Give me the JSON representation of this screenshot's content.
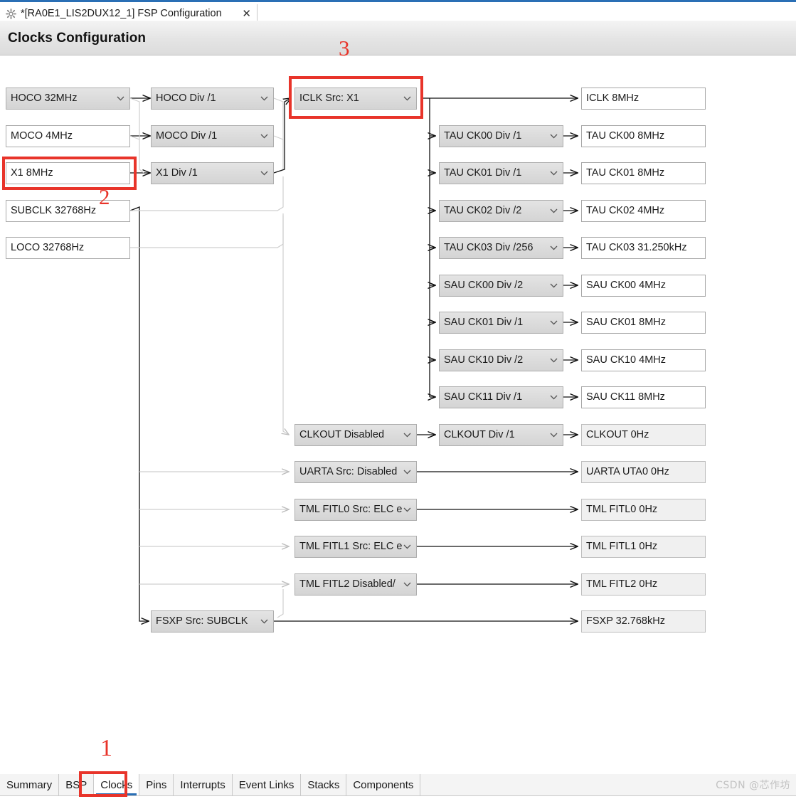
{
  "window": {
    "tab_title": "*[RA0E1_LIS2DUX12_1] FSP Configuration",
    "close_label": "✕",
    "gear_icon": "gear-icon"
  },
  "header": {
    "title": "Clocks Configuration"
  },
  "annotations": [
    {
      "id": "1",
      "label": "1",
      "target": "clocks-tab"
    },
    {
      "id": "2",
      "label": "2",
      "target": "x1-source-node"
    },
    {
      "id": "3",
      "label": "3",
      "target": "iclk-src-node"
    }
  ],
  "diagram": {
    "sources": [
      {
        "name": "hoco-source",
        "label": "HOCO 32MHz",
        "type": "combo"
      },
      {
        "name": "moco-source",
        "label": "MOCO 4MHz",
        "type": "static"
      },
      {
        "name": "x1-source",
        "label": "X1 8MHz",
        "type": "static"
      },
      {
        "name": "subclk-source",
        "label": "SUBCLK 32768Hz",
        "type": "static"
      },
      {
        "name": "loco-source",
        "label": "LOCO 32768Hz",
        "type": "static"
      }
    ],
    "dividers": [
      {
        "name": "hoco-div",
        "label": "HOCO Div /1"
      },
      {
        "name": "moco-div",
        "label": "MOCO Div /1"
      },
      {
        "name": "x1-div",
        "label": "X1 Div /1"
      },
      {
        "name": "fsxp-src",
        "label": "FSXP Src: SUBCLK"
      }
    ],
    "selectors": [
      {
        "name": "iclk-src",
        "label": "ICLK Src: X1"
      },
      {
        "name": "clkout-src",
        "label": "CLKOUT Disabled"
      },
      {
        "name": "uarta-src",
        "label": "UARTA Src: Disabled"
      },
      {
        "name": "tml-fitl0-src",
        "label": "TML FITL0 Src: ELC e"
      },
      {
        "name": "tml-fitl1-src",
        "label": "TML FITL1 Src: ELC e"
      },
      {
        "name": "tml-fitl2-src",
        "label": "TML FITL2 Disabled/"
      }
    ],
    "peripheral_divs": [
      {
        "name": "tau-ck00-div",
        "label": "TAU CK00 Div /1"
      },
      {
        "name": "tau-ck01-div",
        "label": "TAU CK01 Div /1"
      },
      {
        "name": "tau-ck02-div",
        "label": "TAU CK02 Div /2"
      },
      {
        "name": "tau-ck03-div",
        "label": "TAU CK03 Div /256"
      },
      {
        "name": "sau-ck00-div",
        "label": "SAU CK00 Div /2"
      },
      {
        "name": "sau-ck01-div",
        "label": "SAU CK01 Div /1"
      },
      {
        "name": "sau-ck10-div",
        "label": "SAU CK10 Div /2"
      },
      {
        "name": "sau-ck11-div",
        "label": "SAU CK11 Div /1"
      },
      {
        "name": "clkout-div",
        "label": "CLKOUT Div /1"
      }
    ],
    "outputs": [
      {
        "name": "iclk-out",
        "label": "ICLK 8MHz",
        "state": "active"
      },
      {
        "name": "tau-ck00-out",
        "label": "TAU CK00 8MHz",
        "state": "active"
      },
      {
        "name": "tau-ck01-out",
        "label": "TAU CK01 8MHz",
        "state": "active"
      },
      {
        "name": "tau-ck02-out",
        "label": "TAU CK02 4MHz",
        "state": "active"
      },
      {
        "name": "tau-ck03-out",
        "label": "TAU CK03 31.250kHz",
        "state": "active"
      },
      {
        "name": "sau-ck00-out",
        "label": "SAU CK00 4MHz",
        "state": "active"
      },
      {
        "name": "sau-ck01-out",
        "label": "SAU CK01 8MHz",
        "state": "active"
      },
      {
        "name": "sau-ck10-out",
        "label": "SAU CK10 4MHz",
        "state": "active"
      },
      {
        "name": "sau-ck11-out",
        "label": "SAU CK11 8MHz",
        "state": "active"
      },
      {
        "name": "clkout-out",
        "label": "CLKOUT 0Hz",
        "state": "disabled"
      },
      {
        "name": "uarta-out",
        "label": "UARTA UTA0 0Hz",
        "state": "disabled"
      },
      {
        "name": "tml-fitl0-out",
        "label": "TML FITL0 0Hz",
        "state": "disabled"
      },
      {
        "name": "tml-fitl1-out",
        "label": "TML FITL1 0Hz",
        "state": "disabled"
      },
      {
        "name": "tml-fitl2-out",
        "label": "TML FITL2 0Hz",
        "state": "disabled"
      },
      {
        "name": "fsxp-out",
        "label": "FSXP 32.768kHz",
        "state": "disabled"
      }
    ]
  },
  "bottom_tabs": [
    {
      "name": "tab-summary",
      "label": "Summary",
      "active": false
    },
    {
      "name": "tab-bsp",
      "label": "BSP",
      "active": false
    },
    {
      "name": "tab-clocks",
      "label": "Clocks",
      "active": true
    },
    {
      "name": "tab-pins",
      "label": "Pins",
      "active": false
    },
    {
      "name": "tab-interrupts",
      "label": "Interrupts",
      "active": false
    },
    {
      "name": "tab-event-links",
      "label": "Event Links",
      "active": false
    },
    {
      "name": "tab-stacks",
      "label": "Stacks",
      "active": false
    },
    {
      "name": "tab-components",
      "label": "Components",
      "active": false
    }
  ],
  "watermark": "CSDN @芯作坊",
  "colors": {
    "accent": "#2a6fb5",
    "annotation": "#e8342a",
    "header_bg": "#e4e4e4",
    "combo_bg": "#dcdcdc"
  }
}
